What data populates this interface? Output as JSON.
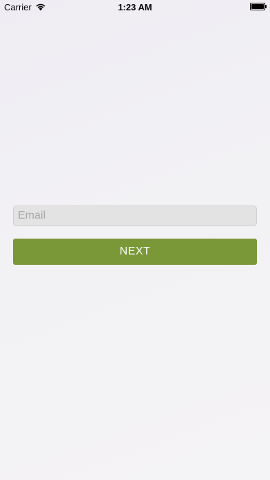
{
  "status_bar": {
    "carrier": "Carrier",
    "time": "1:23 AM",
    "battery_level": 1.0,
    "wifi_icon": "wifi-icon",
    "battery_icon": "battery-icon"
  },
  "login": {
    "email_placeholder": "Email",
    "email_value": "",
    "next_label": "NEXT"
  },
  "colors": {
    "accent": "#7a9838",
    "input_background": "#e4e3e3"
  }
}
